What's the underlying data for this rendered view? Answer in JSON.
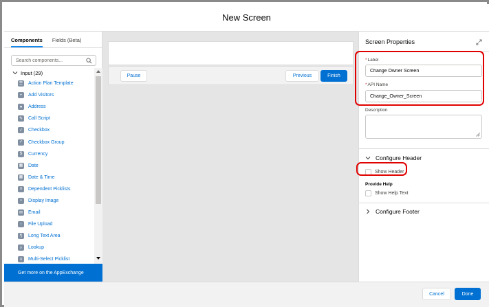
{
  "modal": {
    "title": "New Screen"
  },
  "left_panel": {
    "tabs": [
      {
        "label": "Components",
        "active": true
      },
      {
        "label": "Fields (Beta)",
        "active": false
      }
    ],
    "search": {
      "placeholder": "Search components..."
    },
    "section": {
      "label": "Input (29)"
    },
    "items": [
      {
        "label": "Action Plan Template",
        "icon": "action-plan-icon"
      },
      {
        "label": "Add Visitors",
        "icon": "add-visitors-icon"
      },
      {
        "label": "Address",
        "icon": "address-icon"
      },
      {
        "label": "Call Script",
        "icon": "call-script-icon"
      },
      {
        "label": "Checkbox",
        "icon": "checkbox-icon"
      },
      {
        "label": "Checkbox Group",
        "icon": "checkbox-group-icon"
      },
      {
        "label": "Currency",
        "icon": "currency-icon"
      },
      {
        "label": "Date",
        "icon": "date-icon"
      },
      {
        "label": "Date & Time",
        "icon": "date-time-icon"
      },
      {
        "label": "Dependent Picklists",
        "icon": "dependent-picklists-icon"
      },
      {
        "label": "Display Image",
        "icon": "display-image-icon"
      },
      {
        "label": "Email",
        "icon": "email-icon"
      },
      {
        "label": "File Upload",
        "icon": "file-upload-icon"
      },
      {
        "label": "Long Text Area",
        "icon": "long-text-area-icon"
      },
      {
        "label": "Lookup",
        "icon": "lookup-icon"
      },
      {
        "label": "Multi-Select Picklist",
        "icon": "multi-select-picklist-icon"
      }
    ],
    "appexchange_label": "Get more on the AppExchange"
  },
  "canvas": {
    "pause_label": "Pause",
    "previous_label": "Previous",
    "finish_label": "Finish"
  },
  "properties": {
    "title": "Screen Properties",
    "label_field": {
      "label": "Label",
      "value": "Change Owner Screen"
    },
    "api_name_field": {
      "label": "API Name",
      "value": "Change_Owner_Screen"
    },
    "description_field": {
      "label": "Description",
      "value": ""
    },
    "configure_header": "Configure Header",
    "show_header": "Show Header",
    "provide_help": "Provide Help",
    "show_help_text": "Show Help Text",
    "configure_footer": "Configure Footer"
  },
  "footer": {
    "cancel_label": "Cancel",
    "done_label": "Done"
  },
  "colors": {
    "brand": "#0070d2",
    "annotation": "#e00000",
    "canvas_bg": "#e5e5e5"
  }
}
